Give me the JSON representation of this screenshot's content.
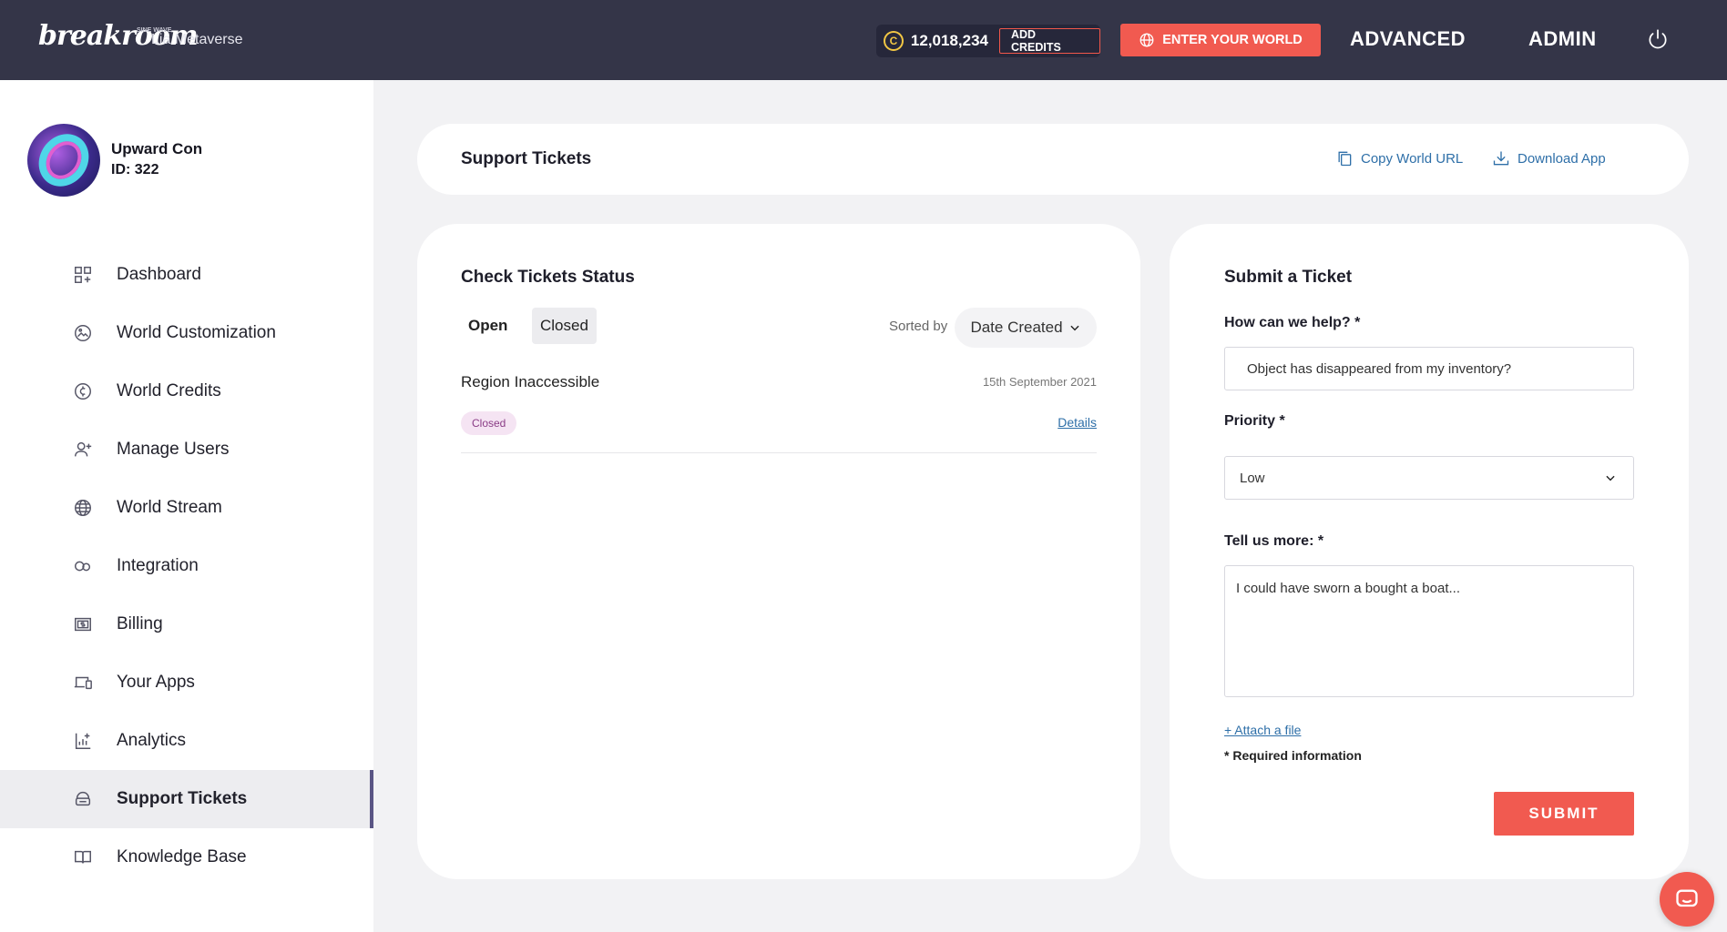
{
  "header": {
    "logo_text": "breakroom",
    "logo_sup": "SINE WAVE",
    "org_name": "Lia Metaverse",
    "credits": "12,018,234",
    "coin_symbol": "C",
    "add_credits_label": "ADD CREDITS",
    "enter_world_label": "ENTER YOUR WORLD",
    "nav_advanced": "ADVANCED",
    "nav_admin": "ADMIN"
  },
  "profile": {
    "name": "Upward Con",
    "id_label": "ID: 322"
  },
  "sidebar": {
    "items": [
      {
        "label": "Dashboard",
        "icon": "dashboard-icon"
      },
      {
        "label": "World Customization",
        "icon": "customization-icon"
      },
      {
        "label": "World Credits",
        "icon": "credits-icon"
      },
      {
        "label": "Manage Users",
        "icon": "add-user-icon"
      },
      {
        "label": "World Stream",
        "icon": "globe-icon"
      },
      {
        "label": "Integration",
        "icon": "integration-icon"
      },
      {
        "label": "Billing",
        "icon": "billing-icon"
      },
      {
        "label": "Your Apps",
        "icon": "devices-icon"
      },
      {
        "label": "Analytics",
        "icon": "analytics-icon"
      },
      {
        "label": "Support Tickets",
        "icon": "support-icon",
        "active": true
      },
      {
        "label": "Knowledge Base",
        "icon": "book-icon"
      }
    ]
  },
  "page": {
    "title": "Support Tickets",
    "copy_url_label": "Copy World URL",
    "download_app_label": "Download App"
  },
  "status_panel": {
    "title": "Check Tickets Status",
    "tabs": [
      {
        "label": "Open",
        "selected": false
      },
      {
        "label": "Closed",
        "selected": true
      }
    ],
    "sorted_by_label": "Sorted by",
    "sort_value": "Date Created",
    "tickets": [
      {
        "title": "Region Inaccessible",
        "date": "15th September 2021",
        "status": "Closed",
        "details_label": "Details"
      }
    ]
  },
  "submit_panel": {
    "title": "Submit a Ticket",
    "help_label": "How can we help? *",
    "help_value": "Object has disappeared from my inventory?",
    "priority_label": "Priority *",
    "priority_value": "Low",
    "more_label": "Tell us more: *",
    "more_value": "I could have sworn a bought a boat...",
    "attach_label": "+ Attach a file",
    "required_note": "* Required information",
    "submit_label": "SUBMIT"
  },
  "colors": {
    "header_bg": "#343548",
    "accent": "#f15a50",
    "link": "#2e6fa8",
    "badge_bg": "#f5e4f3"
  }
}
